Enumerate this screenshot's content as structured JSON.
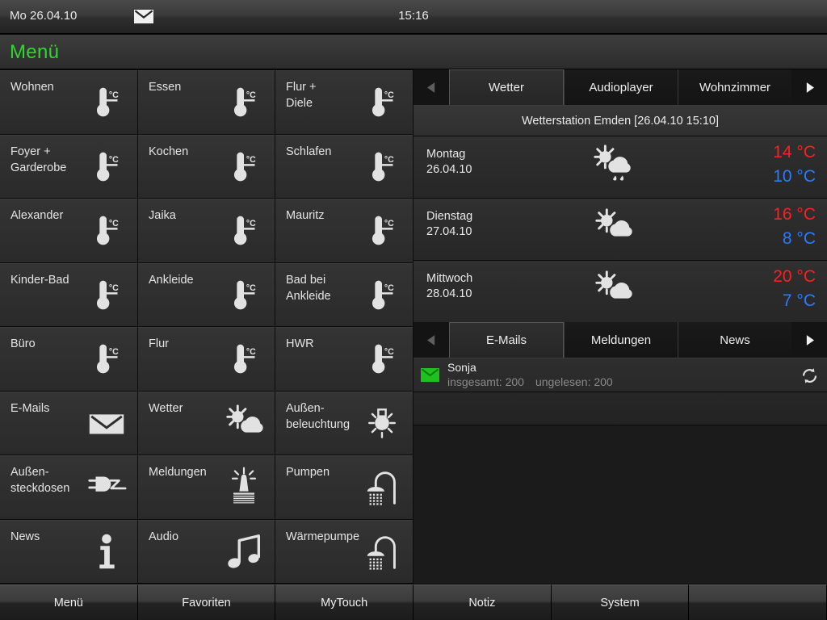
{
  "statusbar": {
    "date": "Mo 26.04.10",
    "time": "15:16",
    "mail_icon": "envelope-icon"
  },
  "titlebar": {
    "title": "Menü",
    "title_color": "#2fd62f"
  },
  "menu_grid": {
    "items": [
      {
        "label": "Wohnen",
        "icon": "thermometer-icon"
      },
      {
        "label": "Essen",
        "icon": "thermometer-icon"
      },
      {
        "label": "Flur + Diele",
        "icon": "thermometer-icon"
      },
      {
        "label": "Foyer + Garderobe",
        "icon": "thermometer-icon"
      },
      {
        "label": "Kochen",
        "icon": "thermometer-icon"
      },
      {
        "label": "Schlafen",
        "icon": "thermometer-icon"
      },
      {
        "label": "Alexander",
        "icon": "thermometer-icon"
      },
      {
        "label": "Jaika",
        "icon": "thermometer-icon"
      },
      {
        "label": "Mauritz",
        "icon": "thermometer-icon"
      },
      {
        "label": "Kinder-Bad",
        "icon": "thermometer-icon"
      },
      {
        "label": "Ankleide",
        "icon": "thermometer-icon"
      },
      {
        "label": "Bad bei Ankleide",
        "icon": "thermometer-icon"
      },
      {
        "label": "Büro",
        "icon": "thermometer-icon"
      },
      {
        "label": "Flur",
        "icon": "thermometer-icon"
      },
      {
        "label": "HWR",
        "icon": "thermometer-icon"
      },
      {
        "label": "E-Mails",
        "icon": "envelope-icon"
      },
      {
        "label": "Wetter",
        "icon": "sun-cloud-icon"
      },
      {
        "label": "Außen-beleuchtung",
        "icon": "outdoor-lamp-icon"
      },
      {
        "label": "Außen-steckdosen",
        "icon": "power-plug-icon"
      },
      {
        "label": "Meldungen",
        "icon": "alarm-siren-icon"
      },
      {
        "label": "Pumpen",
        "icon": "shower-pump-icon"
      },
      {
        "label": "News",
        "icon": "info-icon"
      },
      {
        "label": "Audio",
        "icon": "music-note-icon"
      },
      {
        "label": "Wärmepumpe",
        "icon": "shower-pump-icon"
      }
    ]
  },
  "weather_panel": {
    "tabs": [
      {
        "label": "Wetter",
        "active": true
      },
      {
        "label": "Audioplayer",
        "active": false
      },
      {
        "label": "Wohnzimmer",
        "active": false
      }
    ],
    "prev_arrow": "chevron-left-icon",
    "next_arrow": "chevron-right-icon",
    "station_header": "Wetterstation Emden  [26.04.10 15:10]",
    "forecast": [
      {
        "day": "Montag",
        "date": "26.04.10",
        "icon": "sun-cloud-rain-icon",
        "high": "14 °C",
        "low": "10 °C"
      },
      {
        "day": "Dienstag",
        "date": "27.04.10",
        "icon": "sun-cloud-icon",
        "high": "16 °C",
        "low": "8 °C"
      },
      {
        "day": "Mittwoch",
        "date": "28.04.10",
        "icon": "sun-cloud-icon",
        "high": "20 °C",
        "low": "7 °C"
      }
    ],
    "high_color": "#ff1f1f",
    "low_color": "#2b7bff"
  },
  "mail_panel": {
    "tabs": [
      {
        "label": "E-Mails",
        "active": true
      },
      {
        "label": "Meldungen",
        "active": false
      },
      {
        "label": "News",
        "active": false
      }
    ],
    "prev_arrow": "chevron-left-icon",
    "next_arrow": "chevron-right-icon",
    "account": {
      "name": "Sonja",
      "total_label": "insgesamt: 200",
      "unread_label": "ungelesen: 200",
      "icon": "green-envelope-icon",
      "refresh_icon": "refresh-icon",
      "icon_color": "#1fc11f"
    }
  },
  "bottombar": {
    "buttons": [
      {
        "label": "Menü"
      },
      {
        "label": "Favoriten"
      },
      {
        "label": "MyTouch"
      },
      {
        "label": "Notiz"
      },
      {
        "label": "System"
      },
      {
        "label": ""
      }
    ]
  }
}
